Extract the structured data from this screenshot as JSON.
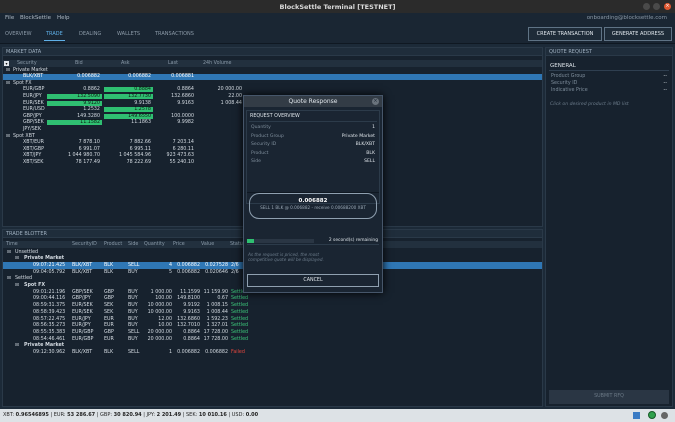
{
  "window": {
    "title": "BlockSettle Terminal [TESTNET]",
    "close": "×"
  },
  "menu": [
    "File",
    "BlockSettle",
    "Help"
  ],
  "user": "onboarding@blocksettle.com",
  "tabs": [
    "OVERVIEW",
    "TRADE",
    "DEALING",
    "WALLETS",
    "TRANSACTIONS"
  ],
  "buttons": {
    "create_tx": "CREATE TRANSACTION",
    "gen_addr": "GENERATE ADDRESS"
  },
  "market": {
    "title": "MARKET DATA",
    "cols": [
      "Security",
      "Bid",
      "Ask",
      "Last",
      "24h Volume"
    ],
    "rows": [
      {
        "k": "g",
        "s": "Private Market"
      },
      {
        "k": "r",
        "sel": true,
        "s": "BLK/XBT",
        "b": "0.006882",
        "a": "0.006882",
        "l": "0.006881",
        "v": ""
      },
      {
        "k": "g",
        "s": "Spot FX"
      },
      {
        "k": "r",
        "s": "EUR/GBP",
        "b": "0.8862",
        "a": "0.8884",
        "l": "0.8864",
        "v": "20 000.00",
        "ga": true
      },
      {
        "k": "r",
        "s": "EUR/JPY",
        "b": "132.5090",
        "a": "132.7730",
        "l": "132.6860",
        "v": "22.00",
        "gb": true,
        "ga": true
      },
      {
        "k": "r",
        "s": "EUR/SEK",
        "b": "9.9120",
        "a": "9.9138",
        "l": "9.9163",
        "v": "1 008.44",
        "gb": true
      },
      {
        "k": "r",
        "s": "EUR/USD",
        "b": "1.2532",
        "a": "1.2578",
        "l": "",
        "v": "",
        "ga": true
      },
      {
        "k": "r",
        "s": "GBP/JPY",
        "b": "149.3280",
        "a": "149.6550",
        "l": "100.0000",
        "v": "",
        "ga": true
      },
      {
        "k": "r",
        "s": "GBP/SEK",
        "b": "11.1582",
        "a": "11.1863",
        "l": "9.9982",
        "v": "",
        "gb": true
      },
      {
        "k": "r",
        "s": "JPY/SEK",
        "b": "",
        "a": "",
        "l": "",
        "v": ""
      },
      {
        "k": "g",
        "s": "Spot XBT"
      },
      {
        "k": "r",
        "s": "XBT/EUR",
        "b": "7 878.10",
        "a": "7 882.66",
        "l": "7 203.14",
        "v": ""
      },
      {
        "k": "r",
        "s": "XBT/GBP",
        "b": "6 991.07",
        "a": "6 995.11",
        "l": "6 280.11",
        "v": ""
      },
      {
        "k": "r",
        "s": "XBT/JPY",
        "b": "1 044 980.70",
        "a": "1 045 584.96",
        "l": "923 473.63",
        "v": ""
      },
      {
        "k": "r",
        "s": "XBT/SEK",
        "b": "78 177.49",
        "a": "78 222.69",
        "l": "55 240.10",
        "v": ""
      }
    ]
  },
  "blotter": {
    "title": "TRADE BLOTTER",
    "cols": [
      "Time",
      "SecurityID",
      "Product",
      "Side",
      "Quantity",
      "Price",
      "Value",
      "Status"
    ],
    "rows": [
      {
        "k": "h",
        "t": "Unsettled",
        "lvl": 0
      },
      {
        "k": "h",
        "t": "Private Market",
        "lvl": 1
      },
      {
        "k": "r",
        "sel": true,
        "t": "09:07:21.425",
        "sec": "BLK/XBT",
        "p": "BLK",
        "sd": "SELL",
        "q": "4",
        "pr": "0.006882",
        "v": "0.027528",
        "st": "2/6"
      },
      {
        "k": "r",
        "t": "09:04:05.792",
        "sec": "BLK/XBT",
        "p": "BLK",
        "sd": "BUY",
        "q": "5",
        "pr": "0.006882",
        "v": "0.020646",
        "st": "2/6"
      },
      {
        "k": "h",
        "t": "Settled",
        "lvl": 0
      },
      {
        "k": "h",
        "t": "Spot FX",
        "lvl": 1
      },
      {
        "k": "r",
        "t": "09:01:21.196",
        "sec": "GBP/SEK",
        "p": "GBP",
        "sd": "BUY",
        "q": "1 000.00",
        "pr": "11.1599",
        "v": "11 159.90",
        "st": "Settled"
      },
      {
        "k": "r",
        "t": "09:00:44.116",
        "sec": "GBP/JPY",
        "p": "GBP",
        "sd": "BUY",
        "q": "100.00",
        "pr": "149.8100",
        "v": "0.67",
        "st": "Settled"
      },
      {
        "k": "r",
        "t": "08:59:31.375",
        "sec": "EUR/SEK",
        "p": "SEK",
        "sd": "BUY",
        "q": "10 000.00",
        "pr": "9.9192",
        "v": "1 008.15",
        "st": "Settled"
      },
      {
        "k": "r",
        "t": "08:58:39.423",
        "sec": "EUR/SEK",
        "p": "SEK",
        "sd": "BUY",
        "q": "10 000.00",
        "pr": "9.9163",
        "v": "1 008.44",
        "st": "Settled"
      },
      {
        "k": "r",
        "t": "08:57:22.475",
        "sec": "EUR/JPY",
        "p": "EUR",
        "sd": "BUY",
        "q": "12.00",
        "pr": "132.6860",
        "v": "1 592.23",
        "st": "Settled"
      },
      {
        "k": "r",
        "t": "08:56:35.273",
        "sec": "EUR/JPY",
        "p": "EUR",
        "sd": "BUY",
        "q": "10.00",
        "pr": "132.7010",
        "v": "1 327.01",
        "st": "Settled"
      },
      {
        "k": "r",
        "t": "08:55:35.383",
        "sec": "EUR/GBP",
        "p": "GBP",
        "sd": "SELL",
        "q": "20 000.00",
        "pr": "0.8864",
        "v": "17 728.00",
        "st": "Settled"
      },
      {
        "k": "r",
        "t": "08:54:46.461",
        "sec": "EUR/GBP",
        "p": "EUR",
        "sd": "BUY",
        "q": "20 000.00",
        "pr": "0.8864",
        "v": "17 728.00",
        "st": "Settled"
      },
      {
        "k": "h",
        "t": "Private Market",
        "lvl": 1
      },
      {
        "k": "r",
        "t": "09:12:30.962",
        "sec": "BLK/XBT",
        "p": "BLK",
        "sd": "SELL",
        "q": "1",
        "pr": "0.006882",
        "v": "0.006882",
        "st": "Failed"
      }
    ]
  },
  "quote_request": {
    "title": "QUOTE REQUEST",
    "general": "GENERAL",
    "fields": [
      {
        "label": "Product Group",
        "value": "--"
      },
      {
        "label": "Security ID",
        "value": "--"
      },
      {
        "label": "Indicative Price",
        "value": "--"
      }
    ],
    "hint": "Click on desired product in MD list",
    "submit": "SUBMIT RFQ"
  },
  "dialog": {
    "title": "Quote Response",
    "section": "REQUEST OVERVIEW",
    "fields": [
      {
        "label": "Quantity",
        "value": "1"
      },
      {
        "label": "Product Group",
        "value": "Private Market"
      },
      {
        "label": "Security ID",
        "value": "BLK/XBT"
      },
      {
        "label": "Product",
        "value": "BLK"
      },
      {
        "label": "Side",
        "value": "SELL"
      }
    ],
    "price": "0.006882",
    "price_desc": "SELL 1 BLK @ 0.006882 - receive 0.00688200 XBT",
    "remaining": "2 second(s) remaining",
    "progress": 0.1,
    "info": "As the request is priced, the most competitive quote will be displayed.",
    "cancel": "CANCEL"
  },
  "status": {
    "prefix": "XBT:",
    "items": [
      {
        "k": "XBT",
        "v": "0.96546895"
      },
      {
        "k": "EUR",
        "v": "53 286.67"
      },
      {
        "k": "GBP",
        "v": "30 820.94"
      },
      {
        "k": "JPY",
        "v": "2 201.49"
      },
      {
        "k": "SEK",
        "v": "10 010.16"
      },
      {
        "k": "USD",
        "v": "0.00"
      }
    ]
  }
}
